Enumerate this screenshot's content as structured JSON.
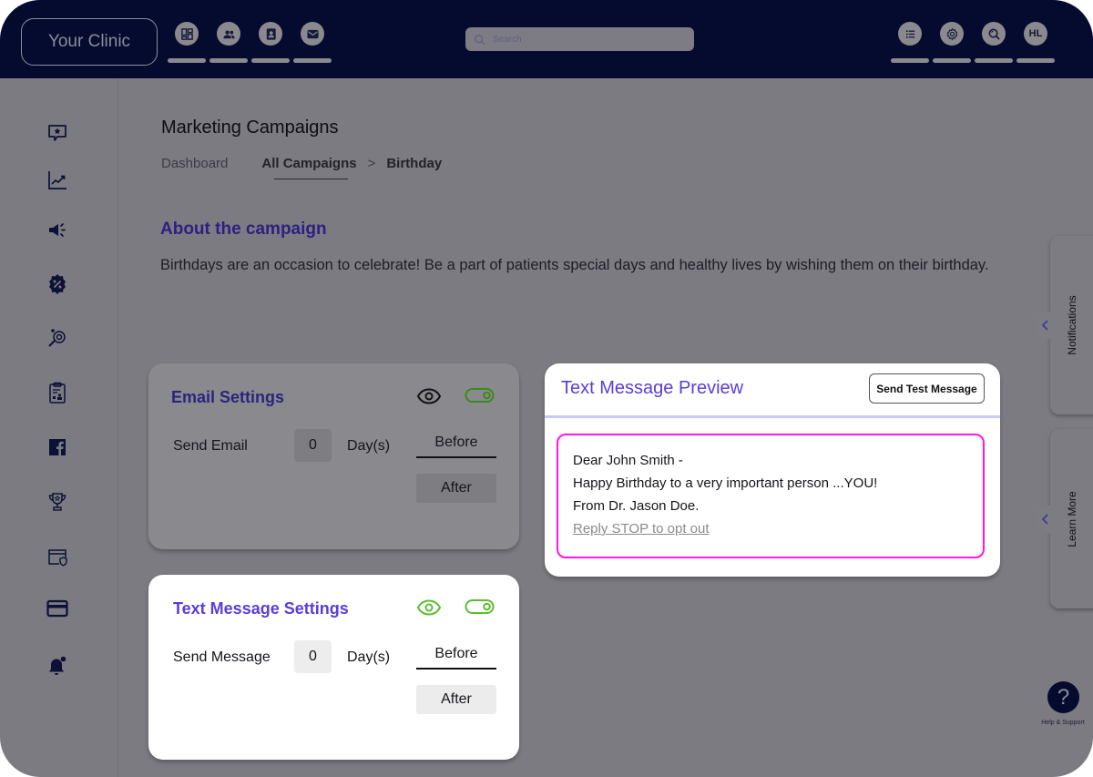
{
  "app": {
    "brand": "Your Clinic"
  },
  "topbar": {
    "left_nav": [
      {
        "icon": "dashboard-grid-icon"
      },
      {
        "icon": "patients-group-icon"
      },
      {
        "icon": "contacts-book-icon"
      },
      {
        "icon": "mail-envelope-icon"
      }
    ],
    "search": {
      "placeholder": "Search",
      "value": ""
    },
    "right_nav": [
      {
        "icon": "list-icon"
      },
      {
        "icon": "settings-gear-icon"
      },
      {
        "icon": "search-zoom-icon"
      },
      {
        "icon": "avatar",
        "initials": "HL"
      }
    ]
  },
  "sidebar": {
    "items": [
      {
        "icon": "reviews-star-chat-icon"
      },
      {
        "icon": "analytics-chart-icon"
      },
      {
        "icon": "marketing-megaphone-icon"
      },
      {
        "icon": "discount-badge-icon"
      },
      {
        "icon": "email-search-icon"
      },
      {
        "icon": "clipboard-report-icon"
      },
      {
        "icon": "facebook-icon"
      },
      {
        "icon": "trophy-icon"
      },
      {
        "icon": "secure-window-icon"
      },
      {
        "icon": "credit-card-icon"
      },
      {
        "icon": "notification-bell-icon"
      }
    ]
  },
  "page": {
    "title": "Marketing Campaigns",
    "breadcrumb": [
      "Dashboard",
      "All Campaigns",
      "Birthday"
    ],
    "breadcrumb_separator": ">"
  },
  "about": {
    "heading": "About the campaign",
    "text": "Birthdays are an occasion to celebrate! Be a part of patients special days and healthy lives by wishing them on their birthday."
  },
  "email_settings": {
    "title": "Email Settings",
    "enabled": true,
    "row_label": "Send Email",
    "days_value": "0",
    "days_label": "Day(s)",
    "options": [
      "Before",
      "After"
    ],
    "selected": "Before"
  },
  "text_settings": {
    "title": "Text Message Settings",
    "enabled": true,
    "row_label": "Send Message",
    "days_value": "0",
    "days_label": "Day(s)",
    "options": [
      "Before",
      "After"
    ],
    "selected": "Before"
  },
  "preview": {
    "title": "Text Message Preview",
    "send_test_label": "Send Test Message",
    "lines": [
      "Dear John Smith -",
      "Happy Birthday to a very important person ...YOU!",
      "From Dr. Jason Doe."
    ],
    "opt_out": "Reply STOP to opt out"
  },
  "right_panels": {
    "notifications_label": "Notifications",
    "learn_more_label": "Learn More"
  },
  "help": {
    "glyph": "?",
    "label": "Help & Support"
  },
  "colors": {
    "topbar": "#050b2f",
    "accent_purple": "#5b3ddb",
    "toggle_green": "#5bbd2e",
    "preview_border": "#ff16e8"
  }
}
